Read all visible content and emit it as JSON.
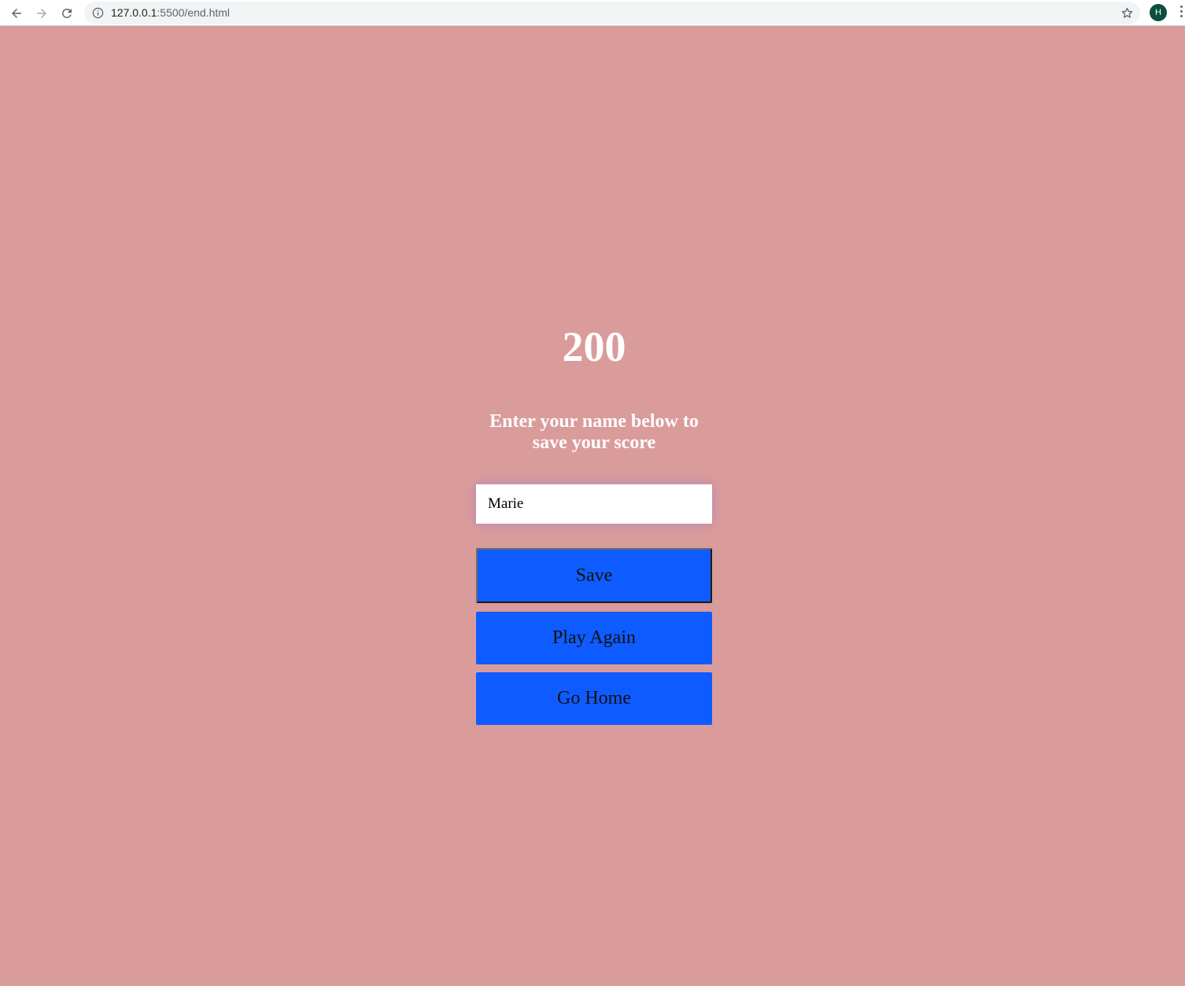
{
  "browser": {
    "url_host": "127.0.0.1",
    "url_rest": ":5500/end.html",
    "profile_initial": "H"
  },
  "end_screen": {
    "score": "200",
    "prompt_line1": "Enter your name below to",
    "prompt_line2": "save your score",
    "name_input_value": "Marie",
    "save_label": "Save",
    "play_again_label": "Play Again",
    "go_home_label": "Go Home"
  },
  "colors": {
    "background": "#da9b9b",
    "button": "#0e5cff",
    "text": "#ffffff"
  }
}
